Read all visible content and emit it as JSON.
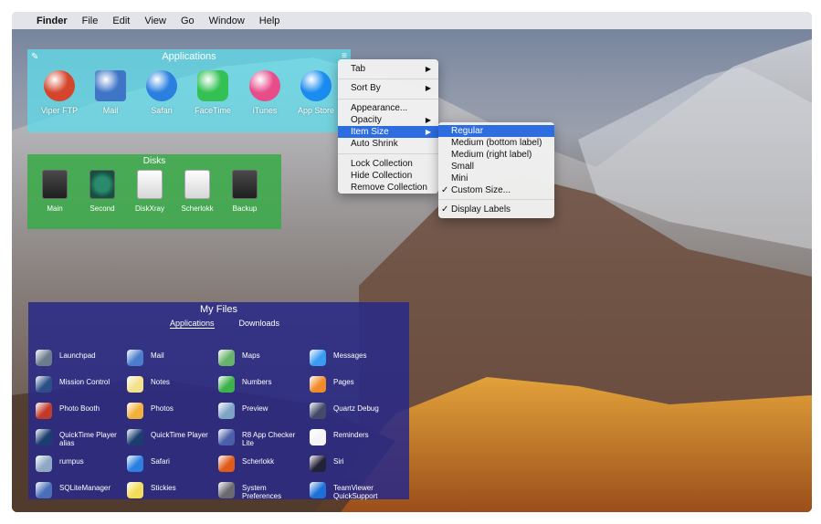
{
  "menubar": {
    "apple": "",
    "app": "Finder",
    "items": [
      "File",
      "Edit",
      "View",
      "Go",
      "Window",
      "Help"
    ]
  },
  "applications": {
    "title": "Applications",
    "items": [
      {
        "label": "Viper FTP",
        "icon": "viper-ftp-icon",
        "color": "#d4462c"
      },
      {
        "label": "Mail",
        "icon": "mail-icon",
        "color": "#3f74c7"
      },
      {
        "label": "Safari",
        "icon": "safari-icon",
        "color": "#2a7fe0"
      },
      {
        "label": "FaceTime",
        "icon": "facetime-icon",
        "color": "#33c153"
      },
      {
        "label": "iTunes",
        "icon": "itunes-icon",
        "color": "#e84d8a"
      },
      {
        "label": "App Store",
        "icon": "app-store-icon",
        "color": "#1a8cf0"
      }
    ]
  },
  "disks": {
    "title": "Disks",
    "items": [
      {
        "label": "Main",
        "style": "dark"
      },
      {
        "label": "Second",
        "style": "tm"
      },
      {
        "label": "DiskXray",
        "style": "white"
      },
      {
        "label": "Scherlokk",
        "style": "white"
      },
      {
        "label": "Backup",
        "style": "dark"
      }
    ]
  },
  "my_files": {
    "title": "My Files",
    "tabs": [
      "Applications",
      "Downloads"
    ],
    "items": [
      {
        "label": "Launchpad",
        "color": "#6b7c8e"
      },
      {
        "label": "Mail",
        "color": "#4a7dcc"
      },
      {
        "label": "Maps",
        "color": "#68b36a"
      },
      {
        "label": "Messages",
        "color": "#3a9cf0"
      },
      {
        "label": "Mission Control",
        "color": "#2d4f88"
      },
      {
        "label": "Notes",
        "color": "#f3e08b"
      },
      {
        "label": "Numbers",
        "color": "#3db24a"
      },
      {
        "label": "Pages",
        "color": "#f08b2b"
      },
      {
        "label": "Photo Booth",
        "color": "#c23a2c"
      },
      {
        "label": "Photos",
        "color": "#f2b13a"
      },
      {
        "label": "Preview",
        "color": "#7fa3c6"
      },
      {
        "label": "Quartz Debug",
        "color": "#444a6a"
      },
      {
        "label": "QuickTime Player alias",
        "color": "#1c3e6e"
      },
      {
        "label": "QuickTime Player",
        "color": "#1c3e6e"
      },
      {
        "label": "R8 App Checker Lite",
        "color": "#4a5fa8"
      },
      {
        "label": "Reminders",
        "color": "#f4f4f4"
      },
      {
        "label": "rumpus",
        "color": "#8fa8c4"
      },
      {
        "label": "Safari",
        "color": "#2a7fe0"
      },
      {
        "label": "Scherlokk",
        "color": "#e05a1a"
      },
      {
        "label": "Siri",
        "color": "#222236"
      },
      {
        "label": "SQLiteManager",
        "color": "#4a6fb8"
      },
      {
        "label": "Stickies",
        "color": "#f3dc5a"
      },
      {
        "label": "System Preferences",
        "color": "#6a6a70"
      },
      {
        "label": "TeamViewer QuickSupport",
        "color": "#1f6fd8"
      }
    ]
  },
  "context_menu": {
    "items": [
      {
        "label": "Tab",
        "arrow": "▶"
      },
      {
        "label": "Sort By",
        "arrow": "▶"
      },
      {
        "label": "Appearance...",
        "arrow": ""
      },
      {
        "label": "Opacity",
        "arrow": "▶"
      },
      {
        "label": "Item Size",
        "arrow": "▶",
        "highlight": true
      },
      {
        "label": "Auto Shrink",
        "arrow": ""
      },
      {
        "label": "Lock Collection",
        "arrow": ""
      },
      {
        "label": "Hide Collection",
        "arrow": ""
      },
      {
        "label": "Remove Collection",
        "arrow": ""
      }
    ]
  },
  "submenu": {
    "items": [
      {
        "label": "Regular",
        "check": "",
        "highlight": true
      },
      {
        "label": "Medium (bottom label)",
        "check": ""
      },
      {
        "label": "Medium (right label)",
        "check": ""
      },
      {
        "label": "Small",
        "check": ""
      },
      {
        "label": "Mini",
        "check": ""
      },
      {
        "label": "Custom Size...",
        "check": "✓"
      },
      {
        "label": "Display Labels",
        "check": "✓"
      }
    ]
  }
}
